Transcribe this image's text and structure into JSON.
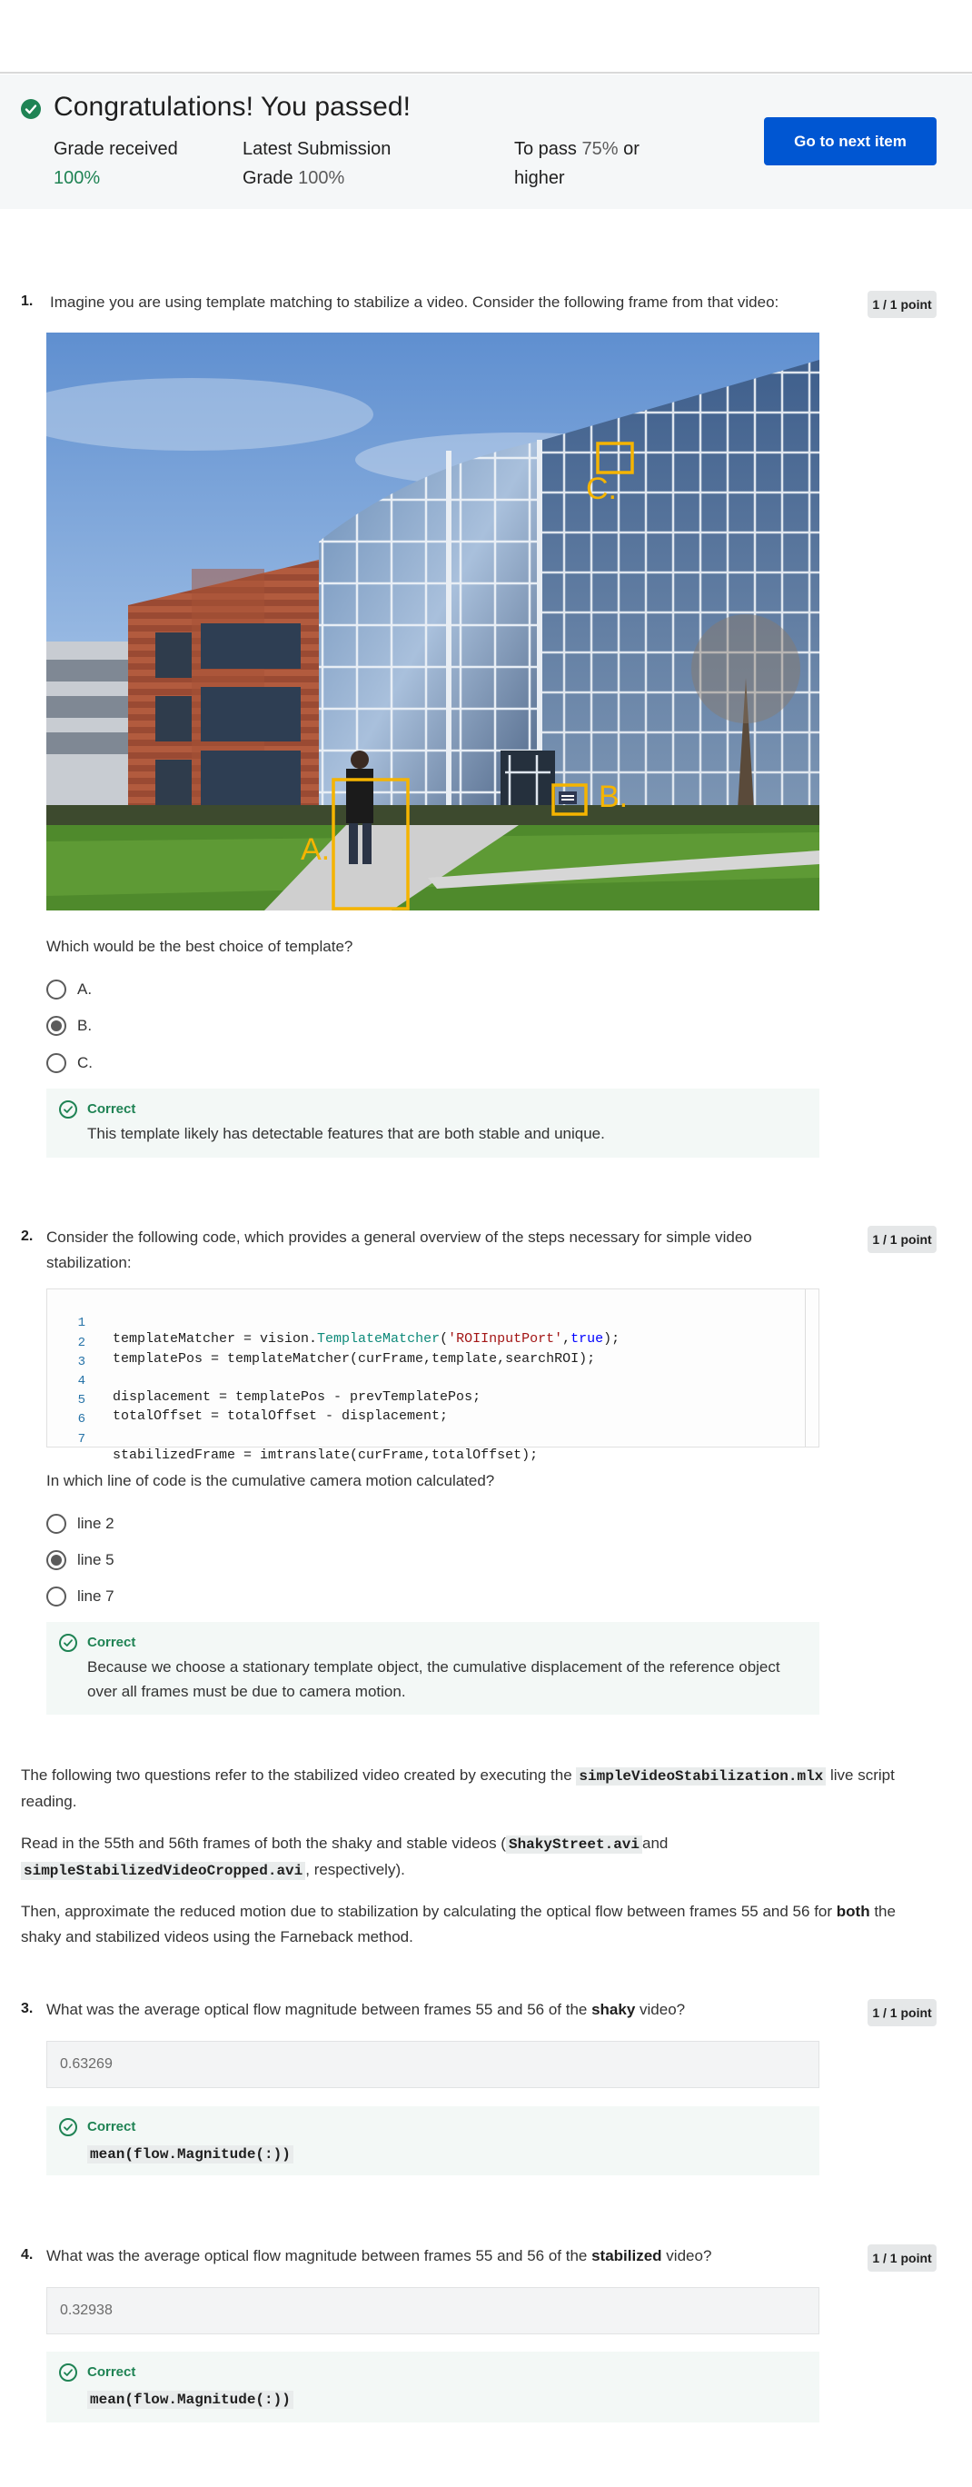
{
  "banner": {
    "title": "Congratulations! You passed!",
    "grade_label": "Grade received",
    "grade_value": "100%",
    "latest_label": "Latest Submission Grade",
    "latest_value": "100%",
    "pass_prefix": "To pass",
    "pass_value": "75%",
    "pass_suffix": "or higher",
    "next_button": "Go to next item"
  },
  "colors": {
    "accent_blue": "#0056d2",
    "success_green": "#1f8354",
    "annotation_yellow": "#f5b400"
  },
  "questions": [
    {
      "number": "1.",
      "text": "Imagine you are using template matching to stabilize a video. Consider the following frame from that video:",
      "points": "1 / 1 point",
      "image_labels": [
        "A.",
        "B.",
        "C."
      ],
      "prompt": "Which would be the best choice of template?",
      "options": [
        "A.",
        "B.",
        "C."
      ],
      "selected_index": 1,
      "feedback_title": "Correct",
      "feedback_text": "This template likely has detectable features that are both stable and unique."
    },
    {
      "number": "2.",
      "text": "Consider the following code, which provides a general overview of the steps necessary for simple video stabilization:",
      "points": "1 / 1 point",
      "code": {
        "line_numbers": [
          "1",
          "2",
          "3",
          "4",
          "5",
          "6",
          "7"
        ],
        "l1_a": "templateMatcher = vision.",
        "l1_b": "TemplateMatcher",
        "l1_c": "(",
        "l1_d": "'ROIInputPort'",
        "l1_e": ",",
        "l1_f": "true",
        "l1_g": ");",
        "l2": "templatePos = templateMatcher(curFrame,template,searchROI);",
        "l3": "",
        "l4": "displacement = templatePos - prevTemplatePos;",
        "l5": "totalOffset = totalOffset - displacement;",
        "l6": "",
        "l7": "stabilizedFrame = imtranslate(curFrame,totalOffset);"
      },
      "prompt": "In which line of code is the cumulative camera motion calculated?",
      "options": [
        "line 2",
        "line 5",
        "line 7"
      ],
      "selected_index": 1,
      "feedback_title": "Correct",
      "feedback_text": "Because we choose a stationary template object, the cumulative displacement of the reference object over all frames must be due to camera motion."
    }
  ],
  "intro": {
    "p1_a": "The following two questions refer to the stabilized video created by executing the",
    "p1_code": "simpleVideoStabilization.mlx",
    "p1_b": "live script reading.",
    "p2_a": "Read in the 55th and 56th frames of both the shaky and stable videos (",
    "p2_code1": "ShakyStreet.avi",
    "p2_b": "and",
    "p2_code2": "simpleStabilizedVideoCropped.avi",
    "p2_c": ", respectively).",
    "p3_a": "Then, approximate the reduced motion due to stabilization by calculating the optical flow between frames 55 and 56 for",
    "p3_bold": "both",
    "p3_b": "the shaky and stabilized videos using the Farneback method."
  },
  "q3": {
    "number": "3.",
    "text_a": "What was the average optical flow magnitude between frames 55 and 56 of the",
    "text_bold": "shaky",
    "text_b": "video?",
    "points": "1 / 1 point",
    "answer": "0.63269",
    "feedback_title": "Correct",
    "feedback_code": "mean(flow.Magnitude(:))"
  },
  "q4": {
    "number": "4.",
    "text_a": "What was the average optical flow magnitude between frames 55 and 56 of the",
    "text_bold": "stabilized",
    "text_b": "video?",
    "points": "1 / 1 point",
    "answer": "0.32938",
    "feedback_title": "Correct",
    "feedback_code": "mean(flow.Magnitude(:))"
  }
}
